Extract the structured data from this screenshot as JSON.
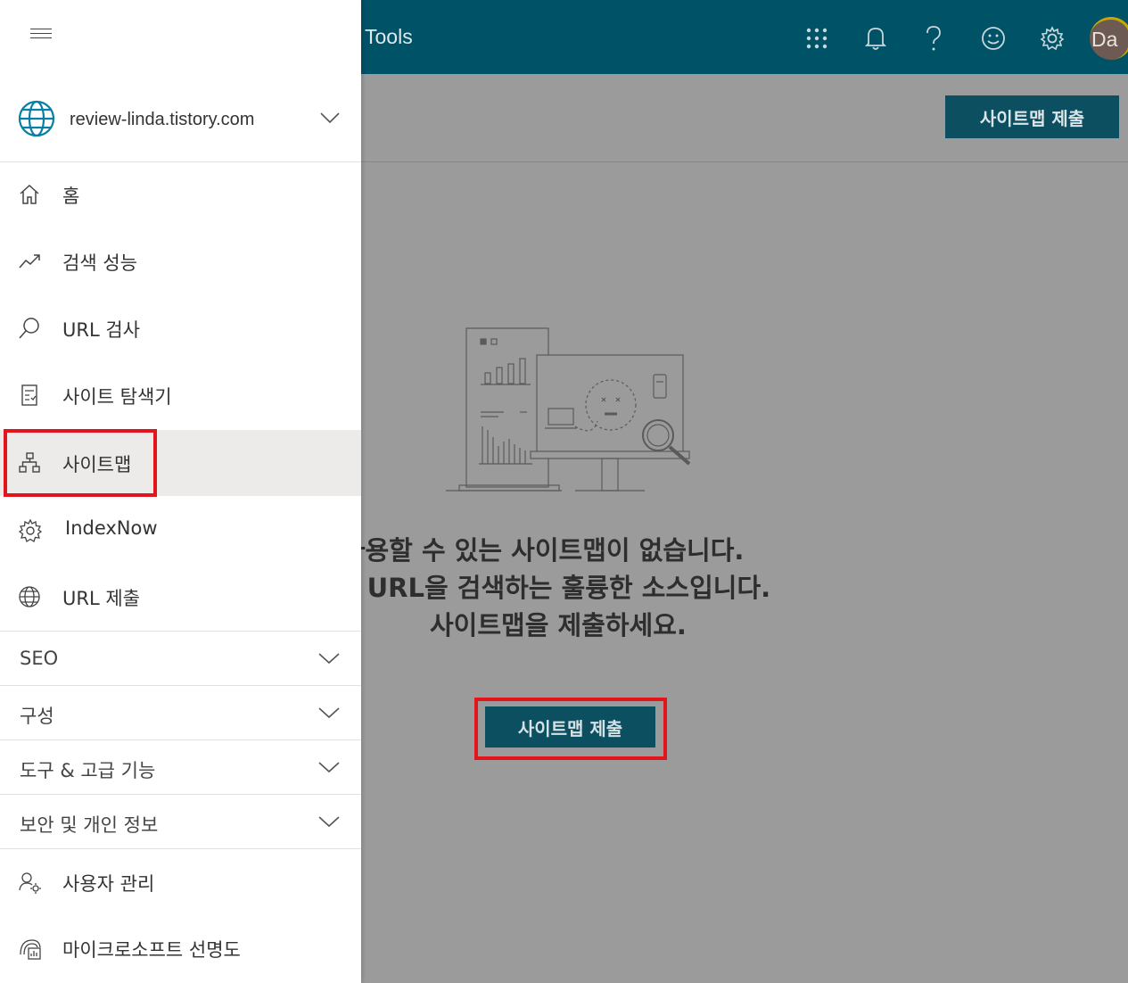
{
  "header": {
    "title_fragment": "Tools",
    "avatar_initials": "Da",
    "icons": [
      "apps-grid-icon",
      "bell-icon",
      "help-icon",
      "smiley-icon",
      "gear-icon"
    ]
  },
  "toolbar": {
    "submit_sitemap_label": "사이트맵 제출"
  },
  "empty_state": {
    "line1": "사이트에 사용할 수 있는 사이트맵이 없습니다.",
    "line2": "사이트맵은 새로운 URL을 검색하는 훌륭한 소스입니다.",
    "line3": "사이트맵을 제출하세요.",
    "button_label": "사이트맵 제출"
  },
  "sidebar": {
    "site_name": "review-linda.tistory.com",
    "items": [
      {
        "label": "홈",
        "icon": "home-icon"
      },
      {
        "label": "검색 성능",
        "icon": "trend-icon"
      },
      {
        "label": "URL 검사",
        "icon": "search-icon"
      },
      {
        "label": "사이트 탐색기",
        "icon": "checklist-icon"
      },
      {
        "label": "사이트맵",
        "icon": "sitemap-icon",
        "selected": true
      },
      {
        "label": "IndexNow",
        "icon": "gear-icon"
      },
      {
        "label": "URL 제출",
        "icon": "globe-icon"
      }
    ],
    "sections": [
      {
        "label": "SEO"
      },
      {
        "label": "구성"
      },
      {
        "label": "도구 & 고급 기능"
      },
      {
        "label": "보안 및 개인 정보"
      }
    ],
    "footer_items": [
      {
        "label": "사용자 관리",
        "icon": "user-settings-icon"
      },
      {
        "label": "마이크로소프트 선명도",
        "icon": "clarity-icon"
      }
    ]
  },
  "colors": {
    "header_bg": "#005266",
    "button_bg": "#0b4f60",
    "highlight": "#e3141c",
    "overlay": "#9b9b9b"
  }
}
